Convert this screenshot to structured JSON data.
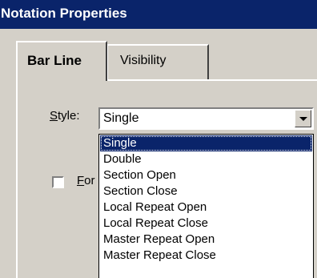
{
  "window": {
    "title": "Notation Properties"
  },
  "tabs": [
    {
      "label": "Bar Line",
      "active": true
    },
    {
      "label": "Visibility",
      "active": false
    }
  ],
  "style_field": {
    "label_mnemonic": "S",
    "label_rest": "tyle:",
    "value": "Single",
    "options": [
      "Single",
      "Double",
      "Section Open",
      "Section Close",
      "Local Repeat Open",
      "Local Repeat Close",
      "Master Repeat Open",
      "Master Repeat Close"
    ],
    "selected_option": "Single"
  },
  "checkbox": {
    "label_mnemonic": "F",
    "label_rest": "or",
    "checked": false
  },
  "colors": {
    "title_bar": "#0a246a",
    "dialog_face": "#d4d0c8",
    "selection": "#0a246a"
  }
}
